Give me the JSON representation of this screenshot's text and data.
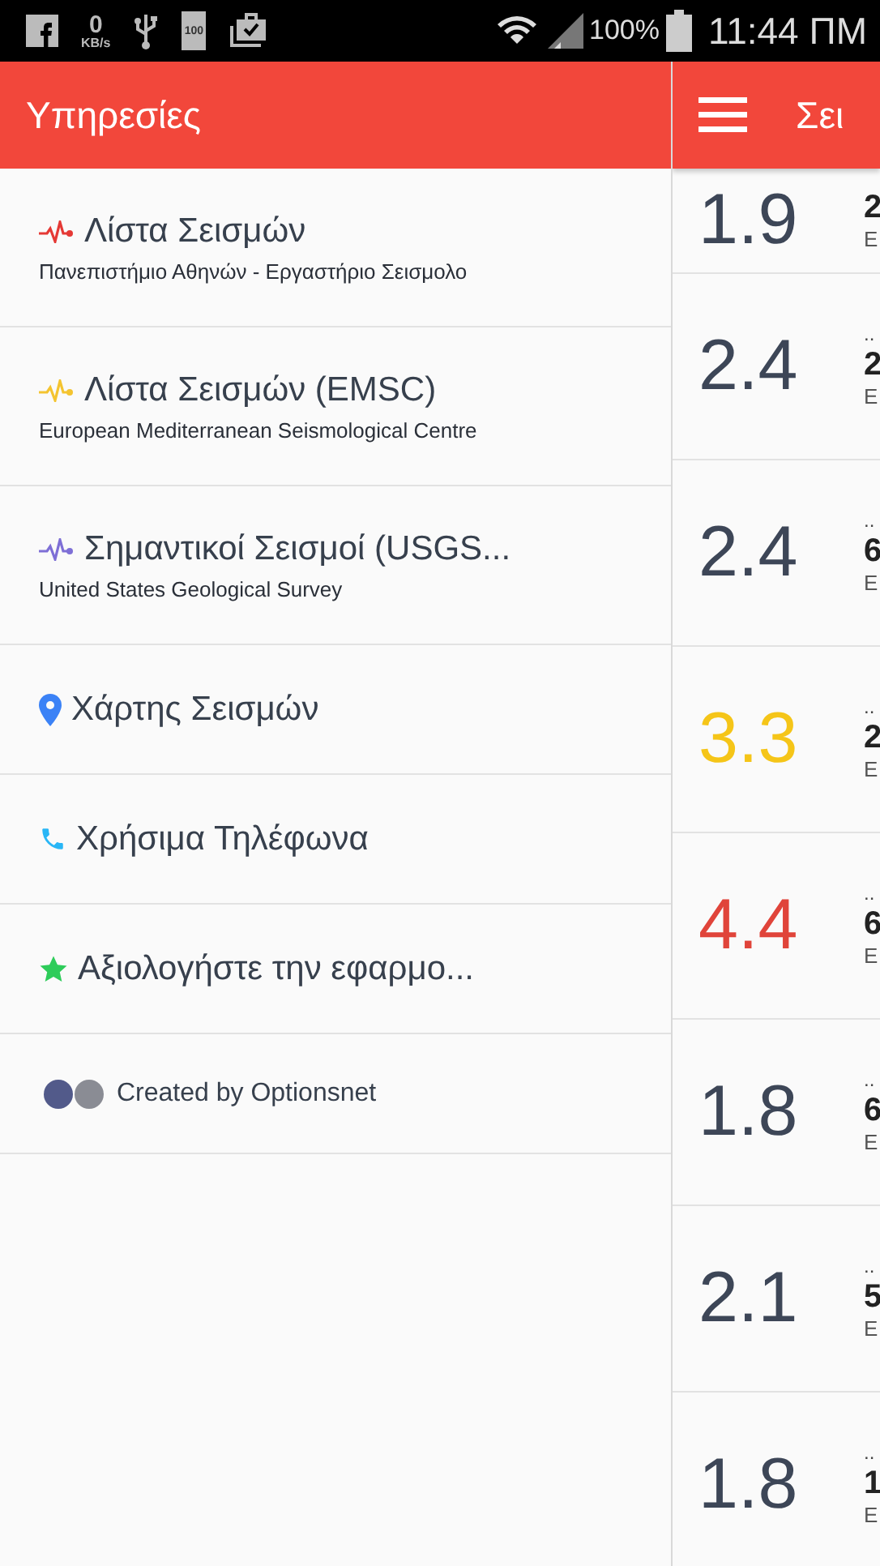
{
  "status_bar": {
    "data_speed": "0",
    "data_unit": "KB/s",
    "battery_badge": "100",
    "battery": "100%",
    "time": "11:44 ΠΜ"
  },
  "drawer": {
    "title": "Υπηρεσίες",
    "items": [
      {
        "kind": "pulse",
        "color": "#e53935",
        "title": "Λίστα Σεισμών",
        "subtitle": "Πανεπιστήμιο Αθηνών - Εργαστήριο Σεισμολο"
      },
      {
        "kind": "pulse",
        "color": "#f4c430",
        "title": "Λίστα Σεισμών (EMSC)",
        "subtitle": "European Mediterranean Seismological Centre"
      },
      {
        "kind": "pulse",
        "color": "#7e6fd6",
        "title": "Σημαντικοί Σεισμοί (USGS...",
        "subtitle": "United States Geological Survey"
      },
      {
        "kind": "pin",
        "color": "#3b82f6",
        "title": "Χάρτης Σεισμών"
      },
      {
        "kind": "phone",
        "color": "#29b6f6",
        "title": "Χρήσιμα Τηλέφωνα"
      },
      {
        "kind": "star",
        "color": "#2ecc5a",
        "title": "Αξιολογήστε την εφαρμο..."
      }
    ],
    "footer": "Created by Optionsnet"
  },
  "main": {
    "title": "Σει",
    "quakes": [
      {
        "magnitude": "1.9",
        "color": "#3d4657",
        "line_2": "2",
        "line_3": "Ε"
      },
      {
        "magnitude": "2.4",
        "color": "#3d4657",
        "line_1": "..",
        "line_2": "2",
        "line_3": "Ε"
      },
      {
        "magnitude": "2.4",
        "color": "#3d4657",
        "line_1": "..",
        "line_2": "6",
        "line_3": "Ε"
      },
      {
        "magnitude": "3.3",
        "color": "#f5c518",
        "line_1": "..",
        "line_2": "2",
        "line_3": "Ε"
      },
      {
        "magnitude": "4.4",
        "color": "#e0443a",
        "line_1": "..",
        "line_2": "6",
        "line_3": "Ε"
      },
      {
        "magnitude": "1.8",
        "color": "#3d4657",
        "line_1": "..",
        "line_2": "6",
        "line_3": "Ε"
      },
      {
        "magnitude": "2.1",
        "color": "#3d4657",
        "line_1": "..",
        "line_2": "5",
        "line_3": "Ε"
      },
      {
        "magnitude": "1.8",
        "color": "#3d4657",
        "line_1": "..",
        "line_2": "1",
        "line_3": "Ε"
      }
    ]
  }
}
